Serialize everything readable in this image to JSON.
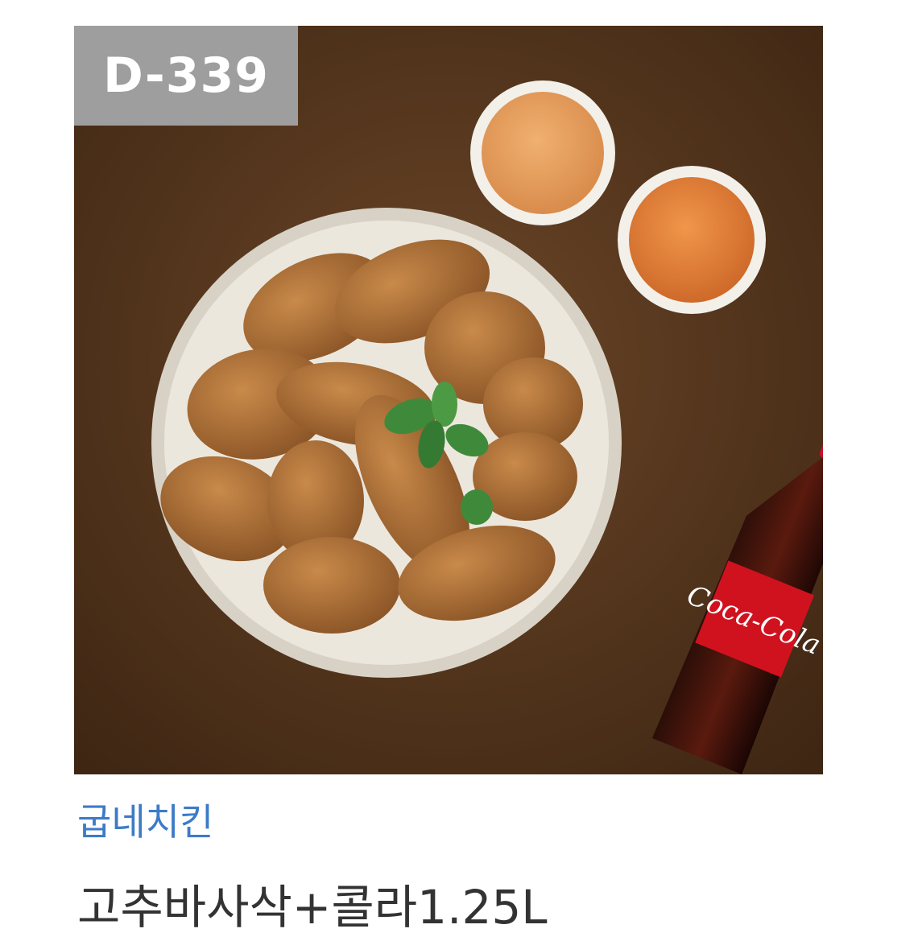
{
  "badge": {
    "dday": "D-339"
  },
  "product": {
    "brand": "굽네치킨",
    "name": "고추바사삭+콜라1.25L"
  },
  "image": {
    "items": [
      "wooden-table",
      "white-plate",
      "roasted-chicken",
      "mint-garnish",
      "dipping-sauce-cups",
      "cola-bottle"
    ],
    "bottle_label": "Coca-Cola"
  },
  "colors": {
    "badge_bg": "#9e9e9e",
    "brand_text": "#3d7bc7",
    "product_text": "#333333",
    "table": "#5a3a20"
  }
}
